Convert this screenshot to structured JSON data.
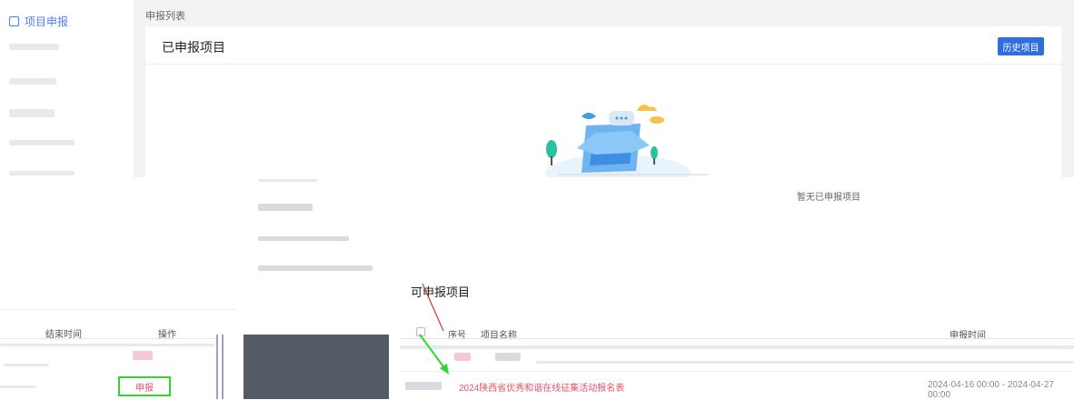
{
  "sidebar": {
    "active_item": "项目申报",
    "active_icon": "document-icon"
  },
  "breadcrumb": "申报列表",
  "declared": {
    "title": "已申报项目",
    "history_button": "历史项目",
    "empty_text": "暂无已申报项目"
  },
  "declared_table": {
    "columns": [
      "结束时间",
      "操作"
    ],
    "action": "申报"
  },
  "available": {
    "title": "可申报项目",
    "columns": [
      "序号",
      "项目名称",
      "申报时间"
    ],
    "row": {
      "name": "2024陕西省优秀和谐在线征集活动报名表",
      "time": "2024-04-16 00:00 - 2024-04-27 00:00"
    }
  },
  "colors": {
    "accent": "#2f6de1",
    "link": "#e8516a",
    "highlight_box": "#32d832",
    "annotation_arrow_red": "#e03030"
  }
}
